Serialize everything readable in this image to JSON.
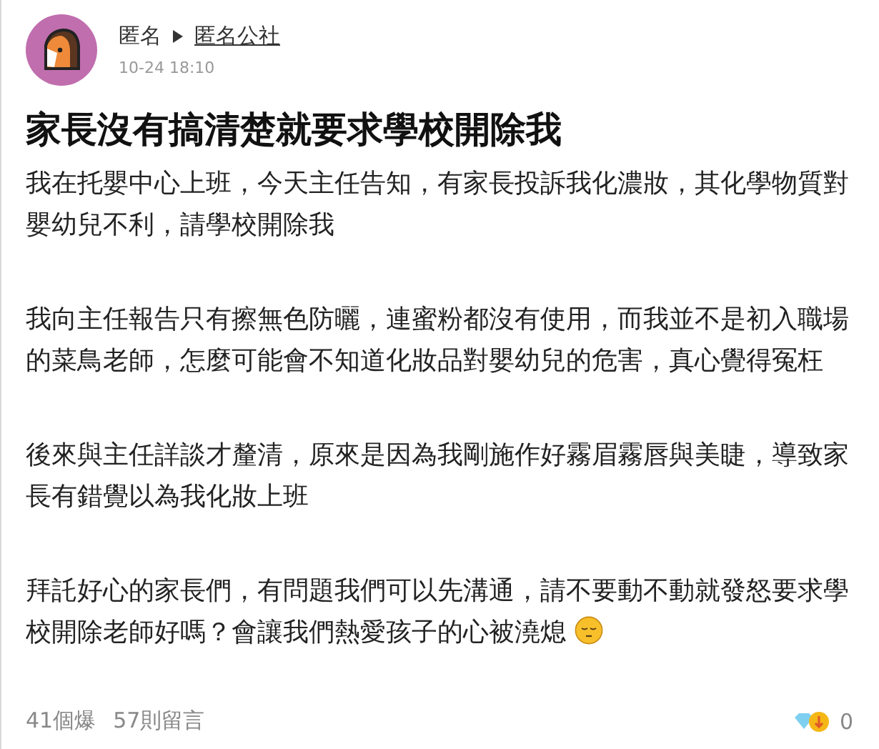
{
  "post": {
    "author": "匿名",
    "board": "匿名公社",
    "time": "10-24 18:10",
    "title": "家長沒有搞清楚就要求學校開除我",
    "paragraphs": [
      {
        "kind": "plain",
        "text": "我在托嬰中心上班，今天主任告知，有家長投訴我化濃妝，其化學物質對嬰幼兒不利，請學校開除我"
      },
      {
        "kind": "plain",
        "text": "我向主任報告只有擦無色防曬，連蜜粉都沒有使用，而我並不是初入職場的菜鳥老師，怎麼可能會不知道化妝品對嬰幼兒的危害，真心覺得冤枉"
      },
      {
        "kind": "plain",
        "text": "後來與主任詳談才釐清，原來是因為我剛施作好霧眉霧唇與美睫，導致家長有錯覺以為我化妝上班"
      },
      {
        "kind": "emoji",
        "text": "拜託好心的家長們，有問題我們可以先溝通，請不要動不動就發怒要求學校開除老師好嗎？會讓我們熱愛孩子的心被澆熄"
      }
    ]
  },
  "footer": {
    "reactions": "41個爆",
    "comments": "57則留言",
    "donations": "0"
  }
}
